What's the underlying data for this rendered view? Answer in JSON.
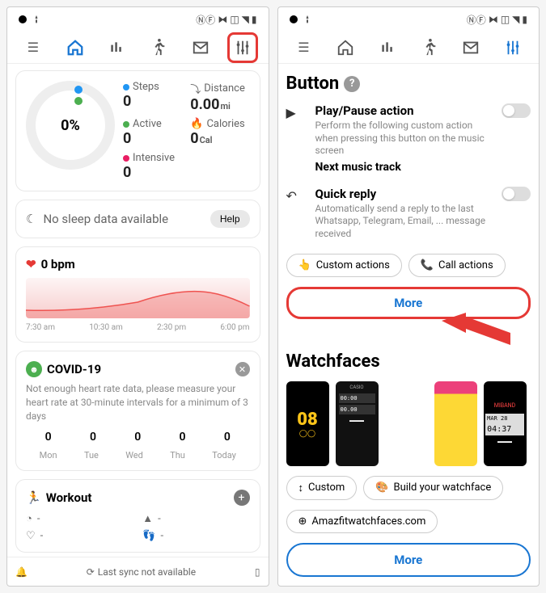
{
  "left": {
    "ring_pct": "0%",
    "metrics": {
      "steps": {
        "label": "Steps",
        "value": "0",
        "color": "#2196f3"
      },
      "distance": {
        "label": "Distance",
        "value": "0.00",
        "unit": "mi"
      },
      "active": {
        "label": "Active",
        "value": "0",
        "color": "#4caf50"
      },
      "calories": {
        "label": "Calories",
        "value": "0",
        "unit": "Cal"
      },
      "intensive": {
        "label": "Intensive",
        "value": "0",
        "color": "#e91e63"
      }
    },
    "sleep": {
      "text": "No sleep data available",
      "help": "Help"
    },
    "hr": {
      "bpm": "0 bpm",
      "times": [
        "7:30 am",
        "10:30 am",
        "2:30 pm",
        "6:00 pm"
      ]
    },
    "covid": {
      "title": "COVID-19",
      "desc": "Not enough heart rate data, please measure your heart rate at 30-minute intervals for a minimum of 3 days",
      "vals": [
        "0",
        "0",
        "0",
        "0",
        "0"
      ],
      "days": [
        "Mon",
        "Tue",
        "Wed",
        "Thu",
        "Today"
      ]
    },
    "workout": {
      "title": "Workout",
      "items": [
        "-",
        "-",
        "-",
        "-"
      ]
    },
    "sync": "Last sync not available"
  },
  "right": {
    "button_section": "Button",
    "playpause": {
      "title": "Play/Pause action",
      "desc": "Perform the following custom action when pressing this button on the music screen",
      "extra": "Next music track"
    },
    "quickreply": {
      "title": "Quick reply",
      "desc": "Automatically send a reply to the last Whatsapp, Telegram, Email, ... message received"
    },
    "custom_actions": "Custom actions",
    "call_actions": "Call actions",
    "more": "More",
    "watchfaces": "Watchfaces",
    "custom": "Custom",
    "build": "Build your watchface",
    "amazfit": "Amazfitwatchfaces.com",
    "more2": "More"
  }
}
